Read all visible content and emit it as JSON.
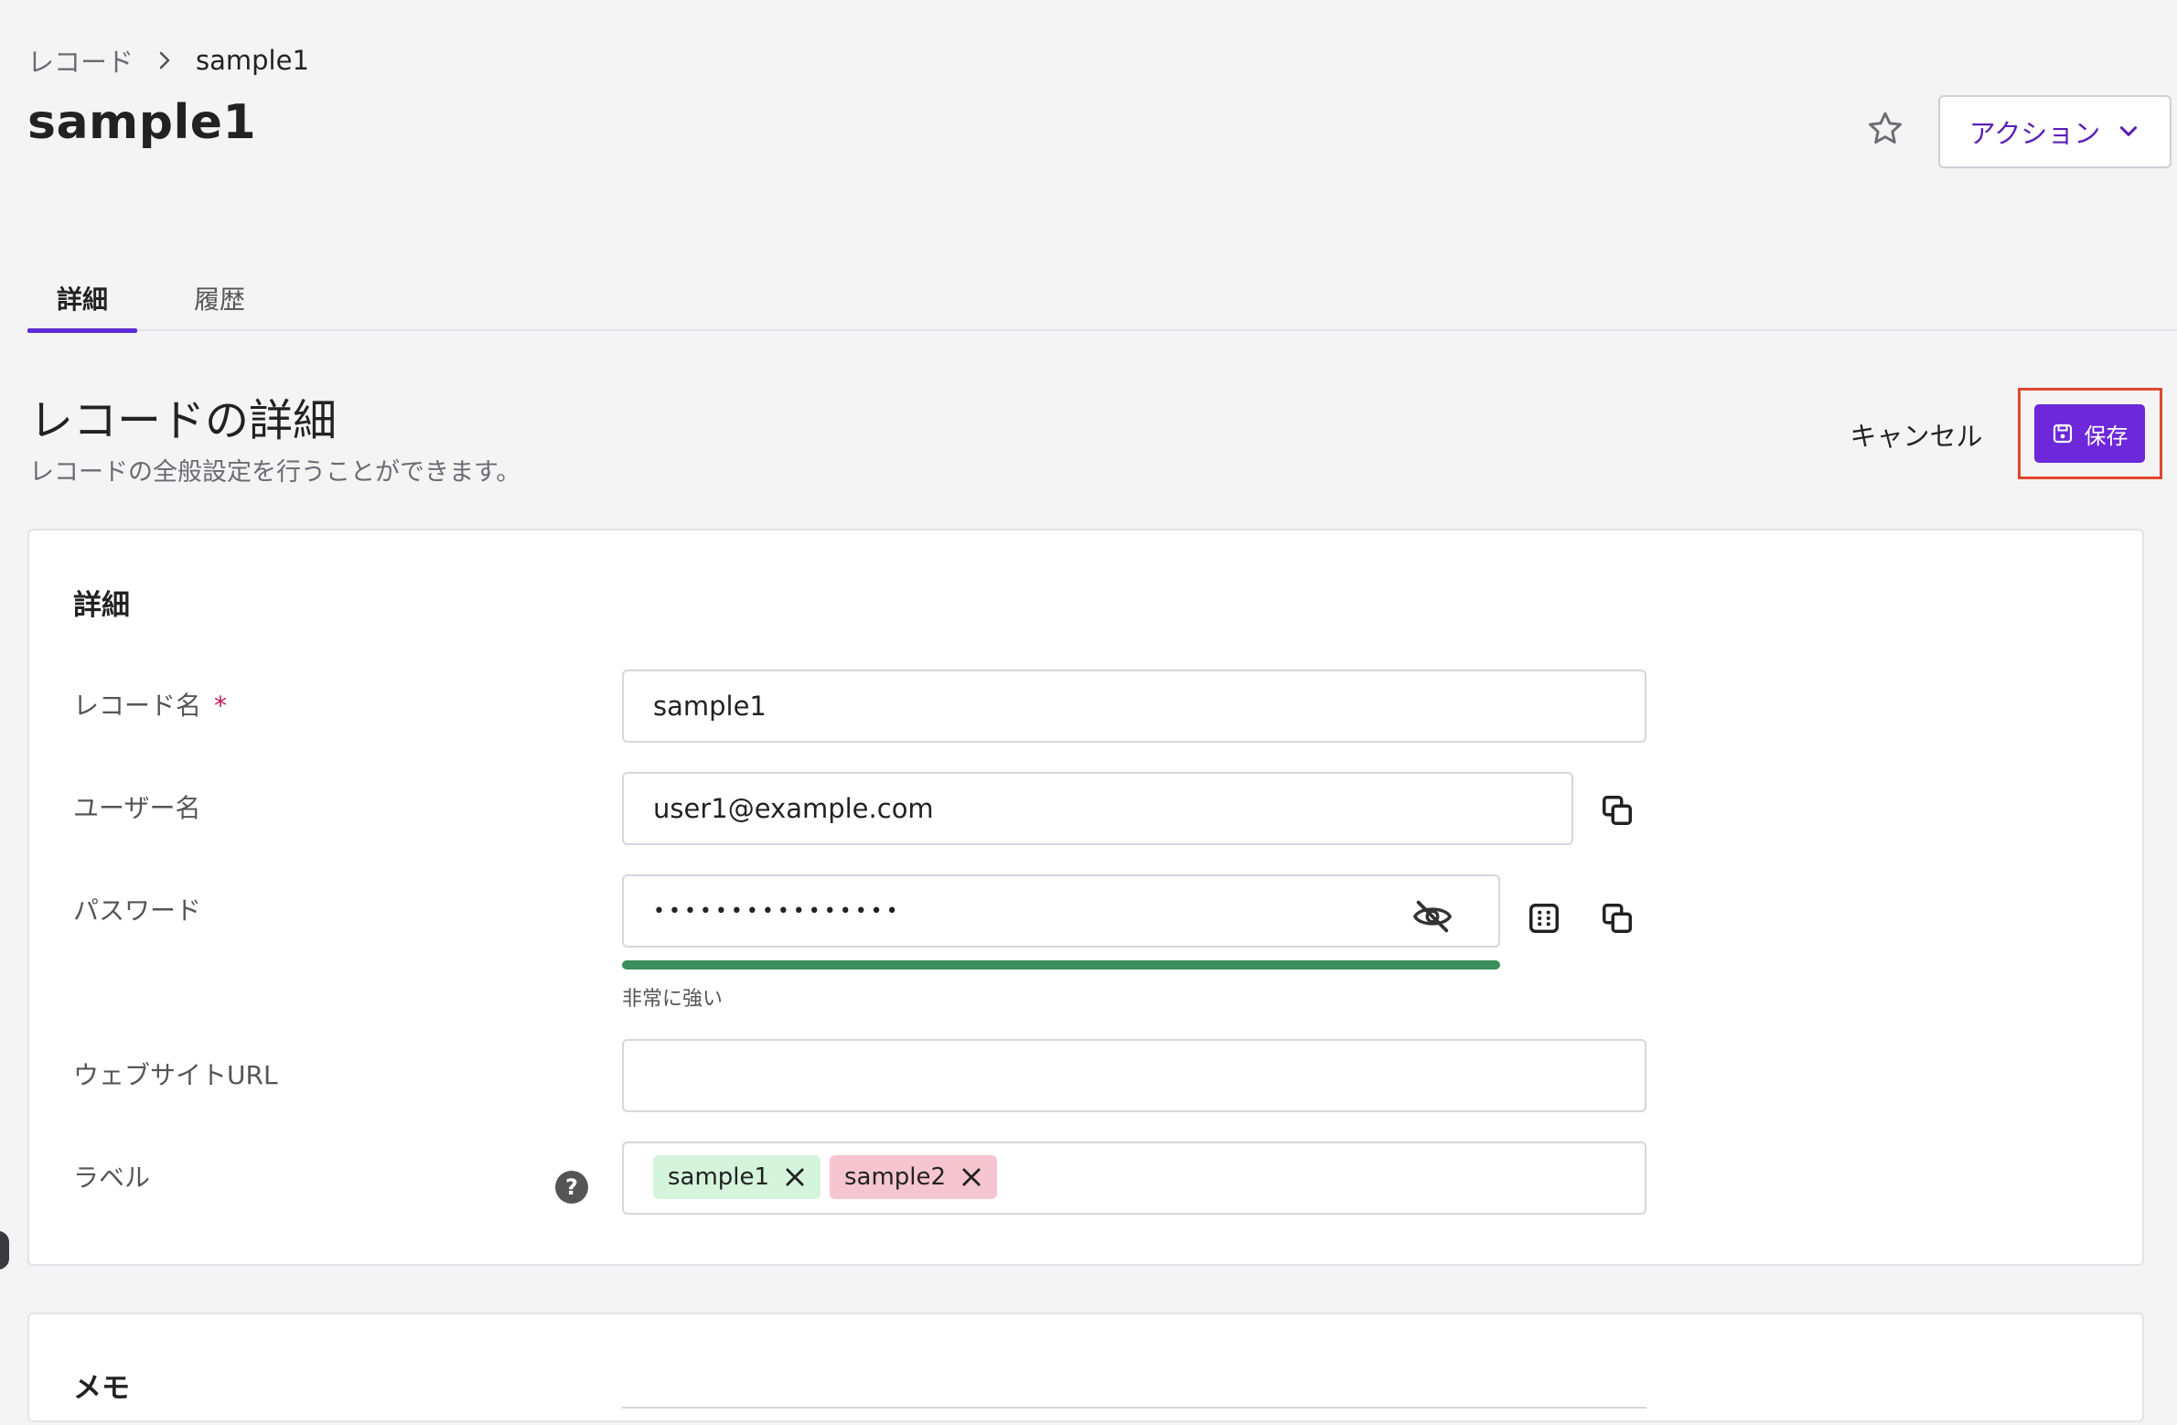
{
  "breadcrumb": {
    "root": "レコード",
    "current": "sample1"
  },
  "page": {
    "title": "sample1"
  },
  "actions": {
    "label": "アクション"
  },
  "tabs": [
    {
      "label": "詳細"
    },
    {
      "label": "履歴"
    }
  ],
  "section": {
    "title": "レコードの詳細",
    "subtitle": "レコードの全般設定を行うことができます。",
    "cancel_label": "キャンセル",
    "save_label": "保存"
  },
  "detail_card": {
    "title": "詳細",
    "fields": {
      "record_name": {
        "label": "レコード名",
        "required_mark": "*",
        "value": "sample1"
      },
      "username": {
        "label": "ユーザー名",
        "value": "user1@example.com"
      },
      "password": {
        "label": "パスワード",
        "value": "••••••••••••••••",
        "strength": "非常に強い",
        "strength_fraction": 1.0
      },
      "website_url": {
        "label": "ウェブサイトURL",
        "value": ""
      },
      "label": {
        "label": "ラベル",
        "help": "?",
        "tags": [
          {
            "text": "sample1",
            "color": "#d4f5dc"
          },
          {
            "text": "sample2",
            "color": "#f6c6d0"
          }
        ]
      }
    }
  },
  "memo_card": {
    "title": "メモ"
  },
  "colors": {
    "accent": "#6d28d9",
    "highlight": "#e0472c",
    "strength": "#3a8f5c"
  }
}
